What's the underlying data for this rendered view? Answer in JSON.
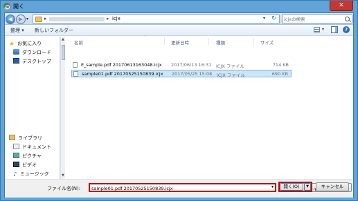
{
  "window": {
    "title": "開く",
    "close_glyph": "✕"
  },
  "address": {
    "path_segment": "icjx",
    "back_glyph": "◀",
    "forward_glyph": "▶",
    "dropdown_glyph": "▾",
    "sep_glyph": "▸",
    "refresh_glyph": "↻"
  },
  "search": {
    "placeholder": "icjxの検索"
  },
  "toolbar": {
    "organize_label": "整理 ▾",
    "new_folder_label": "新しいフォルダー",
    "view_dd_glyph": "▾",
    "help_glyph": "?"
  },
  "nav": {
    "favorites": [
      {
        "label": "お気に入り",
        "icon": "star-icon"
      },
      {
        "label": "ダウンロード",
        "icon": "download-folder-icon"
      },
      {
        "label": "デスクトップ",
        "icon": "desktop-icon"
      }
    ],
    "libraries": [
      {
        "label": "ライブラリ",
        "icon": "library-icon"
      },
      {
        "label": "ドキュメント",
        "icon": "documents-icon"
      },
      {
        "label": "ピクチャ",
        "icon": "pictures-icon"
      },
      {
        "label": "ビデオ",
        "icon": "videos-icon"
      },
      {
        "label": "ミュージック",
        "icon": "music-icon"
      }
    ],
    "star_glyph": "★",
    "music_glyph": "♪"
  },
  "columns": {
    "name": "名前",
    "modified": "更新日時",
    "type": "種類",
    "size": "サイズ"
  },
  "files": [
    {
      "name": "E_sample.pdf 20170613163048.icjx",
      "modified": "2017/06/13 16:31",
      "type": "ICJX ファイル",
      "size": "714 KB"
    },
    {
      "name": "sample01.pdf 20170525150839.icjx",
      "modified": "2017/05/25 15:08",
      "type": "ICJX ファイル",
      "size": "690 KB"
    }
  ],
  "bottom": {
    "filename_label": "ファイル名(N):",
    "filename_value": "sample01.pdf 20170525150839.icjx",
    "filename_dd_glyph": "▾",
    "filetype_value": "カスタム ファイル",
    "filetype_dd_glyph": "▾",
    "open_label": "開く(O)",
    "open_dd_glyph": "▼",
    "cancel_label": "キャンセル"
  },
  "colors": {
    "titlebar": "#62a4d8",
    "close": "#c7372f",
    "highlight": "#c00000",
    "selection": "#cde6f7"
  }
}
